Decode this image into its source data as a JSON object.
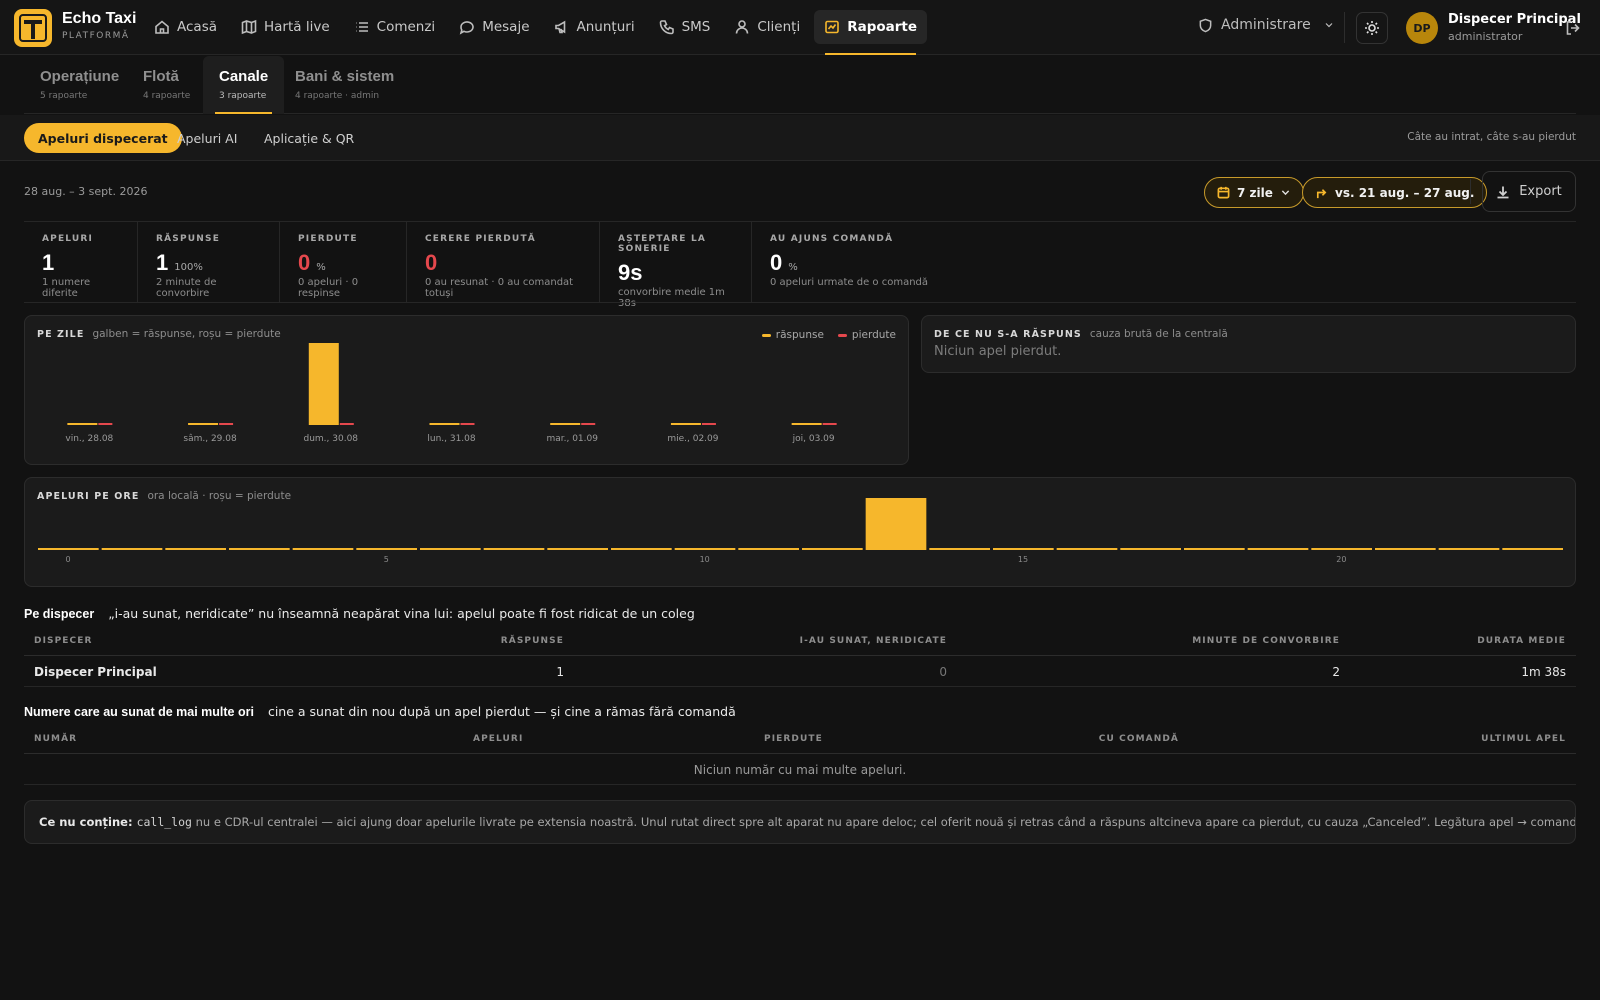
{
  "brand": {
    "name": "Echo Taxi",
    "sub": "PLATFORMĂ"
  },
  "nav": [
    {
      "label": "Acasă",
      "icon": "home-icon"
    },
    {
      "label": "Hartă live",
      "icon": "map-icon"
    },
    {
      "label": "Comenzi",
      "icon": "list-icon"
    },
    {
      "label": "Mesaje",
      "icon": "chat-icon"
    },
    {
      "label": "Anunțuri",
      "icon": "megaphone-icon"
    },
    {
      "label": "SMS",
      "icon": "phone-icon"
    },
    {
      "label": "Clienți",
      "icon": "user-icon"
    },
    {
      "label": "Rapoarte",
      "icon": "report-icon",
      "active": true
    }
  ],
  "admin_label": "Administrare",
  "user": {
    "initials": "DP",
    "name": "Dispecer Principal",
    "role": "administrator"
  },
  "categories": [
    {
      "title": "Operațiune",
      "sub": "5 rapoarte"
    },
    {
      "title": "Flotă",
      "sub": "4 rapoarte"
    },
    {
      "title": "Canale",
      "sub": "3 rapoarte",
      "active": true
    },
    {
      "title": "Bani & sistem",
      "sub": "4 rapoarte · admin"
    }
  ],
  "subtabs": [
    "Apeluri dispecerat",
    "Apeluri AI",
    "Aplicație & QR"
  ],
  "subtab_hint": "Câte au intrat, câte s-au pierdut",
  "filters": {
    "date_range": "28 aug. – 3 sept. 2026",
    "period": "7 zile",
    "compare": "vs. 21 aug. – 27 aug.",
    "export": "Export"
  },
  "stats": [
    {
      "label": "APELURI",
      "value": "1",
      "unit": "",
      "sub": "1 numere diferite",
      "red": false
    },
    {
      "label": "RĂSPUNSE",
      "value": "1",
      "unit": "100%",
      "sub": "2 minute de convorbire",
      "red": false
    },
    {
      "label": "PIERDUTE",
      "value": "0",
      "unit": "%",
      "sub": "0 apeluri · 0 respinse",
      "red": true
    },
    {
      "label": "CERERE PIERDUTĂ",
      "value": "0",
      "unit": "",
      "sub": "0 au resunat · 0 au comandat totuși",
      "red": true
    },
    {
      "label": "AȘTEPTARE LA SONERIE",
      "value": "9s",
      "unit": "",
      "sub": "convorbire medie 1m 38s",
      "red": false
    },
    {
      "label": "AU AJUNS COMANDĂ",
      "value": "0",
      "unit": "%",
      "sub": "0 apeluri urmate de o comandă",
      "red": false
    }
  ],
  "colors": {
    "accent": "#f6b72c",
    "answered": "#f6b72c",
    "missed": "#e5484d"
  },
  "daily_card": {
    "title": "PE ZILE",
    "hint": "galben = răspunse, roșu = pierdute",
    "legend_answered": "răspunse",
    "legend_missed": "pierdute"
  },
  "reasons_card": {
    "title": "DE CE NU S-A RĂSPUNS",
    "hint": "cauza brută de la centrală",
    "empty": "Niciun apel pierdut."
  },
  "hourly_card": {
    "title": "APELURI PE ORE",
    "hint": "ora locală · roșu = pierdute"
  },
  "chart_data": [
    {
      "type": "bar",
      "categories": [
        "vin., 28.08",
        "sâm., 29.08",
        "dum., 30.08",
        "lun., 31.08",
        "mar., 01.09",
        "mie., 02.09",
        "joi, 03.09"
      ],
      "series": [
        {
          "name": "răspunse",
          "values": [
            0,
            0,
            1,
            0,
            0,
            0,
            0
          ]
        },
        {
          "name": "pierdute",
          "values": [
            0,
            0,
            0,
            0,
            0,
            0,
            0
          ]
        }
      ],
      "title": "PE ZILE"
    },
    {
      "type": "bar",
      "categories": [
        "0",
        "1",
        "2",
        "3",
        "4",
        "5",
        "6",
        "7",
        "8",
        "9",
        "10",
        "11",
        "12",
        "13",
        "14",
        "15",
        "16",
        "17",
        "18",
        "19",
        "20",
        "21",
        "22",
        "23"
      ],
      "tick_labels": [
        "0",
        "5",
        "10",
        "15",
        "20"
      ],
      "series": [
        {
          "name": "răspunse",
          "values": [
            0,
            0,
            0,
            0,
            0,
            0,
            0,
            0,
            0,
            0,
            0,
            0,
            0,
            1,
            0,
            0,
            0,
            0,
            0,
            0,
            0,
            0,
            0,
            0
          ]
        },
        {
          "name": "pierdute",
          "values": [
            0,
            0,
            0,
            0,
            0,
            0,
            0,
            0,
            0,
            0,
            0,
            0,
            0,
            0,
            0,
            0,
            0,
            0,
            0,
            0,
            0,
            0,
            0,
            0
          ]
        }
      ],
      "title": "APELURI PE ORE"
    }
  ],
  "dispatch": {
    "title": "Pe dispecer",
    "hint": "„i-au sunat, neridicate” nu înseamnă neapărat vina lui: apelul poate fi fost ridicat de un coleg",
    "headers": [
      "DISPECER",
      "RĂSPUNSE",
      "I-AU SUNAT, NERIDICATE",
      "MINUTE DE CONVORBIRE",
      "DURATA MEDIE"
    ],
    "rows": [
      [
        "Dispecer Principal",
        "1",
        "0",
        "2",
        "1m 38s"
      ]
    ]
  },
  "repeat": {
    "title": "Numere care au sunat de mai multe ori",
    "hint": "cine a sunat din nou după un apel pierdut — și cine a rămas fără comandă",
    "headers": [
      "NUMĂR",
      "APELURI",
      "PIERDUTE",
      "CU COMANDĂ",
      "ULTIMUL APEL"
    ],
    "empty": "Niciun număr cu mai multe apeluri."
  },
  "note": {
    "label": "Ce nu conține:",
    "code": "call_log",
    "text": " nu e CDR-ul centralei — aici ajung doar apelurile livrate pe extensia noastră. Unul rutat direct spre alt aparat nu apare deloc; cel oferit nouă și retras când a răspuns altcineva apare ca pierdut, cu cauza „Canceled”. Legătura apel → comandă e dedusă pe număr + timp."
  }
}
